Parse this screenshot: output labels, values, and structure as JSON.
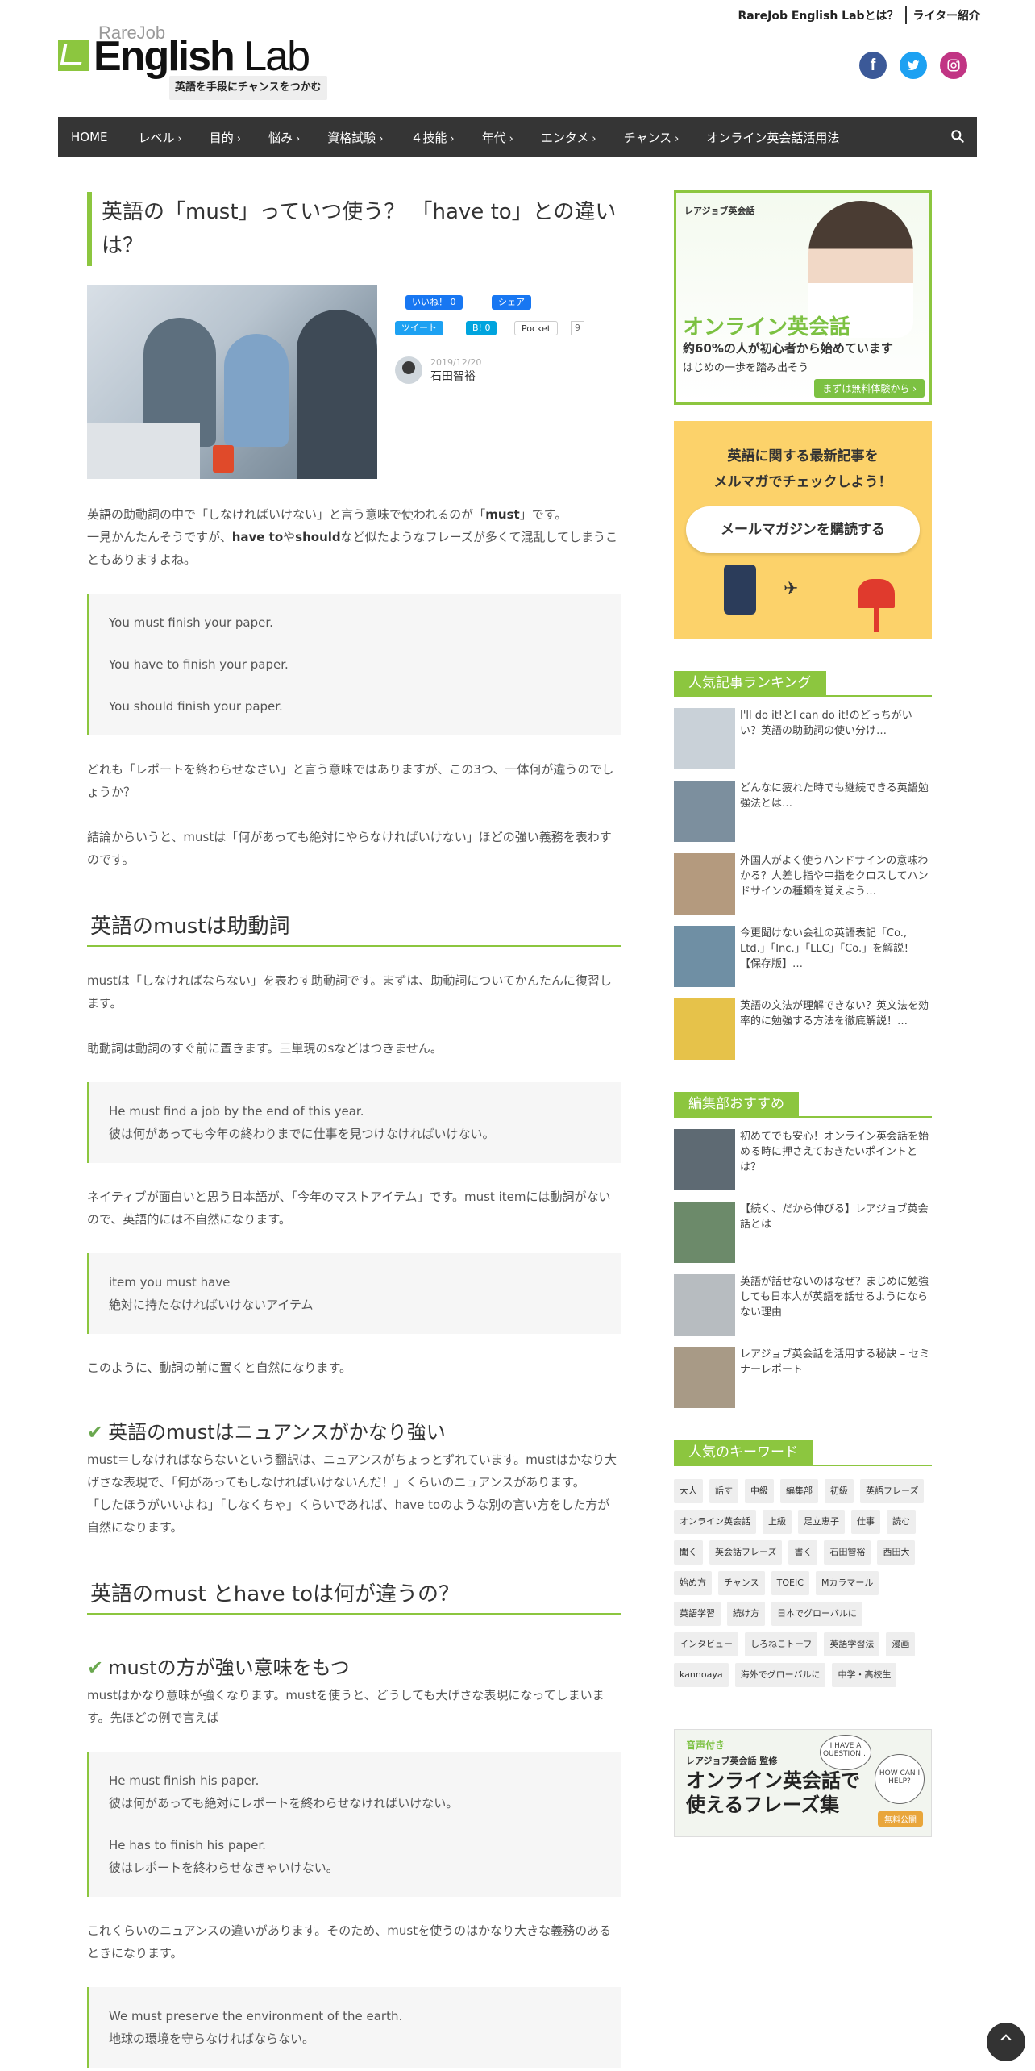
{
  "header": {
    "about_link": "RareJob English Labとは？",
    "writers_link": "ライター紹介",
    "logo_rare": "RareJob",
    "logo_english": "English",
    "logo_lab": "Lab",
    "logo_tagline": "英語を手段にチャンスをつかむ",
    "social": [
      "f",
      "t",
      "ig"
    ]
  },
  "nav": {
    "items": [
      {
        "label": "HOME",
        "chevron": ""
      },
      {
        "label": "レベル",
        "chevron": "›"
      },
      {
        "label": "目的",
        "chevron": "›"
      },
      {
        "label": "悩み",
        "chevron": "›"
      },
      {
        "label": "資格試験",
        "chevron": "›"
      },
      {
        "label": "４技能",
        "chevron": "›"
      },
      {
        "label": "年代",
        "chevron": "›"
      },
      {
        "label": "エンタメ",
        "chevron": "›"
      },
      {
        "label": "チャンス",
        "chevron": "›"
      },
      {
        "label": "オンライン英会話活用法",
        "chevron": ""
      }
    ]
  },
  "article": {
    "title": "英語の「must」っていつ使う？ 「have to」との違いは？",
    "share": {
      "like": "いいね！ 0",
      "fb_share": "シェア",
      "tweet": "ツイート",
      "hatena": "B! 0",
      "pocket": "Pocket",
      "pocket_count": "9"
    },
    "date": "2019/12/20",
    "author": "石田智裕",
    "p1a": "英語の助動詞の中で「しなければいけない」と言う意味で使われるのが「",
    "p1b": "must",
    "p1c": "」です。",
    "p1d": "一見かんたんそうですが、",
    "p1e": "have to",
    "p1f": "や",
    "p1g": "should",
    "p1h": "など似たようなフレーズが多くて混乱してしまうこともありますよね。",
    "q1": [
      "You must finish your paper.",
      "You have to finish your paper.",
      "You should finish your paper."
    ],
    "p2": "どれも「レポートを終わらせなさい」と言う意味ではありますが、この3つ、一体何が違うのでしょうか？",
    "p3": "結論からいうと、mustは「何があっても絶対にやらなければいけない」ほどの強い義務を表わすのです。",
    "h2a": "英語のmustは助動詞",
    "p4": "mustは「しなければならない」を表わす助動詞です。まずは、助動詞についてかんたんに復習します。",
    "p5": "助動詞は動詞のすぐ前に置きます。三単現のsなどはつきません。",
    "q2": [
      "He must find a job by the end of this year.",
      "彼は何があっても今年の終わりまでに仕事を見つけなければいけない。"
    ],
    "p6": "ネイティブが面白いと思う日本語が、「今年のマストアイテム」です。must itemには動詞がないので、英語的には不自然になります。",
    "q3": [
      "item you must have",
      "絶対に持たなければいけないアイテム"
    ],
    "p7": "このように、動詞の前に置くと自然になります。",
    "h3a": "英語のmustはニュアンスがかなり強い",
    "p8a": "must＝しなければならないという翻訳は、ニュアンスがちょっとずれています。mustはかなり大げさな表現で、「何があってもしなければいけないんだ！」くらいのニュアンスがあります。",
    "p8b": "「したほうがいいよね」「しなくちゃ」くらいであれば、have toのような別の言い方をした方が自然になります。",
    "h2b": "英語のmust とhave toは何が違うの？",
    "h3b": "mustの方が強い意味をもつ",
    "p9": "mustはかなり意味が強くなります。mustを使うと、どうしても大げさな表現になってしまいます。先ほどの例で言えば",
    "q4": [
      "He must finish his paper.",
      "彼は何があっても絶対にレポートを終わらせなければいけない。",
      "He has to finish his paper.",
      "彼はレポートを終わらせなきゃいけない。"
    ],
    "p10": "これくらいのニュアンスの違いがあります。そのため、mustを使うのはかなり大きな義務のあるときになります。",
    "q5": [
      "We must preserve the environment of the earth.",
      "地球の環境を守らなければならない。"
    ]
  },
  "sidebar": {
    "ad1": {
      "brand": "レアジョブ英会話",
      "headline": "オンライン英会話",
      "sub": "約60%の人が初心者から始めています",
      "sub2": "はじめの一歩を踏み出そう",
      "cta": "まずは無料体験から ›"
    },
    "ad2": {
      "line1": "英語に関する最新記事を",
      "line2": "メルマガでチェックしよう！",
      "cta": "メールマガジンを購読する"
    },
    "ranking_title": "人気記事ランキング",
    "ranking": [
      {
        "text": "I'll do it!とI can do it!のどっちがいい？英語の助動詞の使い分け…",
        "color": "#c9d1d8"
      },
      {
        "text": "どんなに疲れた時でも継続できる英語勉強法とは…",
        "color": "#7c8f9e"
      },
      {
        "text": "外国人がよく使うハンドサインの意味わかる？人差し指や中指をクロスしてハンドサインの種類を覚えよう…",
        "color": "#b49a7e"
      },
      {
        "text": "今更聞けない会社の英語表記「Co., Ltd.」「Inc.」「LLC」「Co.」を解説！【保存版】…",
        "color": "#6f8fa4"
      },
      {
        "text": "英語の文法が理解できない？英文法を効率的に勉強する方法を徹底解説！…",
        "color": "#e6c24a"
      }
    ],
    "editor_title": "編集部おすすめ",
    "editor": [
      {
        "text": "初めてでも安心！オンライン英会話を始める時に押さえておきたいポイントとは？",
        "color": "#5e6a73"
      },
      {
        "text": "【続く、だから伸びる】レアジョブ英会話とは",
        "color": "#6c8a6a"
      },
      {
        "text": "英語が話せないのはなぜ？まじめに勉強しても日本人が英語を話せるようにならない理由",
        "color": "#b7bcc0"
      },
      {
        "text": "レアジョブ英会話を活用する秘訣 – セミナーレポート",
        "color": "#a89a86"
      }
    ],
    "keywords_title": "人気のキーワード",
    "keywords": [
      "大人",
      "話す",
      "中級",
      "編集部",
      "初級",
      "英語フレーズ",
      "オンライン英会話",
      "上級",
      "足立恵子",
      "仕事",
      "読む",
      "聞く",
      "英会話フレーズ",
      "書く",
      "石田智裕",
      "西田大",
      "始め方",
      "チャンス",
      "TOEIC",
      "Mカラマール",
      "英語学習",
      "続け方",
      "日本でグローバルに",
      "インタビュー",
      "しろねこトーフ",
      "英語学習法",
      "漫画",
      "kannoaya",
      "海外でグローバルに",
      "中学・高校生"
    ],
    "ad3": {
      "a": "音声付き",
      "b": "レアジョブ英会話 監修",
      "c1": "オンライン英会話で",
      "c2": "使えるフレーズ集",
      "bubble1": "I HAVE A QUESTION…",
      "bubble2": "HOW CAN I HELP?",
      "cta": "無料公開"
    }
  },
  "colors": {
    "accent": "#8cc63f",
    "nav_bg": "#353535"
  }
}
